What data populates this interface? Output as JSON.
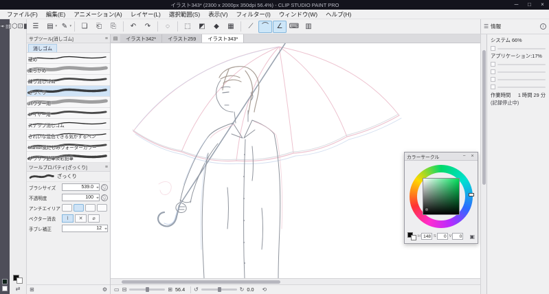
{
  "window": {
    "title": "イラスト343* (2300 x 2000px 350dpi 56.4%)  - CLIP STUDIO PAINT PRO",
    "controls": [
      "─",
      "□",
      "×"
    ]
  },
  "menubar": {
    "items": [
      "ファイル(F)",
      "編集(E)",
      "アニメーション(A)",
      "レイヤー(L)",
      "選択範囲(S)",
      "表示(V)",
      "フィルター(I)",
      "ウィンドウ(W)",
      "ヘルプ(H)"
    ]
  },
  "cmdbar": {
    "icons": [
      {
        "g": "☰",
        "n": "main-menu-icon"
      },
      {
        "g": "▤",
        "n": "workspace-icon",
        "dd": true
      },
      {
        "g": "✎",
        "n": "pen-preset-icon",
        "dd": true
      },
      {
        "sep": true
      },
      {
        "g": "❏",
        "n": "new-file-icon"
      },
      {
        "g": "⎗",
        "n": "open-file-icon"
      },
      {
        "g": "⎘",
        "n": "save-file-icon"
      },
      {
        "sep": true
      },
      {
        "g": "↶",
        "n": "undo-icon"
      },
      {
        "g": "↷",
        "n": "redo-icon"
      },
      {
        "sep": true
      },
      {
        "g": "◌",
        "n": "deselect-icon"
      },
      {
        "sep": true
      },
      {
        "g": "⬚",
        "n": "select-area-icon"
      },
      {
        "g": "◩",
        "n": "eraser-command-icon"
      },
      {
        "g": "◆",
        "n": "fill-icon"
      },
      {
        "g": "▦",
        "n": "grid-icon"
      },
      {
        "sep": true
      },
      {
        "g": "⟋",
        "n": "ruler-snap-icon"
      },
      {
        "g": "⌒",
        "n": "snap-curve-icon",
        "hl": true
      },
      {
        "g": "∠",
        "n": "snap-angle-icon",
        "hl": true
      },
      {
        "g": "⌨",
        "n": "shortcut-keyboard-icon"
      },
      {
        "g": "▥",
        "n": "material-panel-icon"
      }
    ]
  },
  "edgebar": {
    "icons": [
      {
        "g": "☰",
        "n": "tools-menu-icon"
      },
      {
        "g": "✥",
        "n": "move-tool-icon"
      },
      {
        "g": "⬚",
        "n": "selection-tool-icon"
      },
      {
        "g": "◌",
        "n": "lasso-tool-icon"
      },
      {
        "g": "⌖",
        "n": "eyedropper-tool-icon"
      },
      {
        "g": "✎",
        "n": "pen-tool-icon"
      },
      {
        "g": "✏",
        "n": "pencil-tool-icon"
      },
      {
        "g": "✑",
        "n": "brush-tool-icon"
      },
      {
        "g": "✒",
        "n": "airbrush-tool-icon"
      },
      {
        "g": "▨",
        "n": "decoration-tool-icon"
      },
      {
        "g": "◪",
        "n": "eraser-tool-icon",
        "selected": true
      },
      {
        "g": "◍",
        "n": "blend-tool-icon"
      },
      {
        "g": "◆",
        "n": "fill-tool-icon"
      },
      {
        "g": "▭",
        "n": "gradient-tool-icon"
      },
      {
        "g": "◇",
        "n": "figure-tool-icon"
      },
      {
        "g": "A",
        "n": "text-tool-icon"
      },
      {
        "g": "⌗",
        "n": "frame-border-tool-icon"
      },
      {
        "g": "⌕",
        "n": "zoom-tool-icon"
      }
    ]
  },
  "toolcol": {
    "icons": [
      {
        "g": "☰",
        "n": "palette-menu-icon"
      },
      {
        "g": "❏",
        "n": "new-layer-icon"
      },
      {
        "g": "⧉",
        "n": "layer-folder-icon"
      },
      {
        "g": "◫",
        "n": "material-icon"
      },
      {
        "g": "⬡",
        "n": "3d-object-icon"
      },
      {
        "g": "⊡",
        "n": "navigator-icon"
      },
      {
        "g": "◧",
        "n": "layer-property-icon"
      },
      {
        "g": "⊞",
        "n": "subtool-detail-icon"
      },
      {
        "g": "⊙",
        "n": "color-history-icon"
      },
      {
        "g": "◨",
        "n": "history-icon"
      }
    ]
  },
  "subtool": {
    "header": "サブツール[消しゴム]",
    "tab": "消しゴム",
    "brushes": [
      {
        "label": "硬め",
        "style": "thin"
      },
      {
        "label": "柔らかめ",
        "style": "soft"
      },
      {
        "label": "練り消しゴム",
        "style": "med"
      },
      {
        "label": "ざっくり",
        "style": "rough",
        "selected": true
      },
      {
        "label": "パウダー用",
        "style": "soft"
      },
      {
        "label": "レイヤー用",
        "style": "med"
      },
      {
        "label": "スナップ消しゴム",
        "style": "thin"
      },
      {
        "label": "きれいな混色できる気がするペン",
        "style": "thin"
      },
      {
        "label": "Marker風にじみウォーターカラー",
        "style": "med"
      },
      {
        "label": "ザラザラ鉛筆淡彩鉛筆",
        "style": "rough"
      }
    ]
  },
  "toolprop": {
    "header": "ツールプロパティ[ざっくり]",
    "name": "ざっくり",
    "brush_size_label": "ブラシサイズ",
    "brush_size": "539.0",
    "opacity_label": "不透明度",
    "opacity": "100",
    "antialias_label": "アンチエイリアス",
    "vector_label": "ベクター消去",
    "stabilize_label": "手ブレ補正",
    "stabilize": "12"
  },
  "tabs": {
    "items": [
      {
        "label": "イラスト342*"
      },
      {
        "label": "イラスト259"
      },
      {
        "label": "イラスト343*",
        "active": true
      }
    ]
  },
  "statusbar": {
    "zoom": "56.4",
    "rotation": "0.0"
  },
  "colorwheel": {
    "title": "カラーサークル",
    "accent": "#00d96a",
    "values": [
      {
        "k": "H",
        "v": "148"
      },
      {
        "k": "S",
        "v": "0"
      },
      {
        "k": "V",
        "v": "0"
      }
    ]
  },
  "info": {
    "title": "情報",
    "system": "システム 66%",
    "app": "アプリケーション:17%",
    "worktime_label": "作業時間",
    "worktime": "1 時間 29 分",
    "status": "(記録停止中)"
  }
}
